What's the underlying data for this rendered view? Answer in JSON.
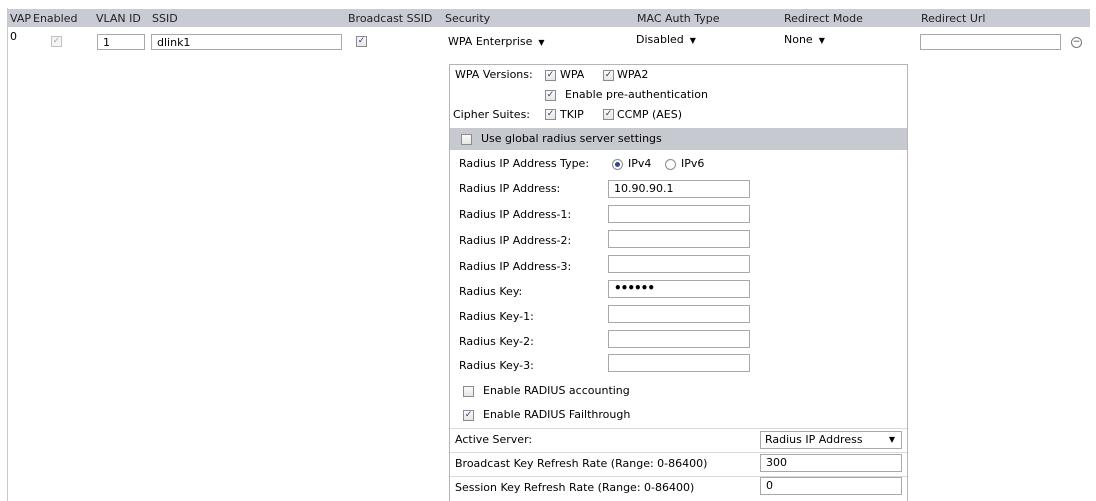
{
  "columns": {
    "vap": "VAP",
    "enabled": "Enabled",
    "vlan_id": "VLAN ID",
    "ssid": "SSID",
    "broadcast_ssid": "Broadcast SSID",
    "security": "Security",
    "mac_auth_type": "MAC Auth Type",
    "redirect_mode": "Redirect Mode",
    "redirect_url": "Redirect Url"
  },
  "row": {
    "vap": "0",
    "vlan_id": "1",
    "ssid": "dlink1",
    "security": "WPA Enterprise",
    "mac_auth_type": "Disabled",
    "redirect_mode": "None",
    "redirect_url": ""
  },
  "wpa": {
    "versions_label": "WPA Versions:",
    "wpa": "WPA",
    "wpa2": "WPA2",
    "preauth": "Enable pre-authentication",
    "cipher_label": "Cipher Suites:",
    "tkip": "TKIP",
    "ccmp": "CCMP (AES)"
  },
  "radius": {
    "use_global": "Use global radius server settings",
    "ip_type_label": "Radius IP Address Type:",
    "ipv4": "IPv4",
    "ipv6": "IPv6",
    "ip_label": "Radius IP Address:",
    "ip_value": "10.90.90.1",
    "ip1_label": "Radius IP Address-1:",
    "ip1_value": "",
    "ip2_label": "Radius IP Address-2:",
    "ip2_value": "",
    "ip3_label": "Radius IP Address-3:",
    "ip3_value": "",
    "key_label": "Radius Key:",
    "key_value": "••••••",
    "key1_label": "Radius Key-1:",
    "key1_value": "",
    "key2_label": "Radius Key-2:",
    "key2_value": "",
    "key3_label": "Radius Key-3:",
    "key3_value": "",
    "accounting": "Enable RADIUS accounting",
    "failthrough": "Enable RADIUS Failthrough",
    "active_server_label": "Active Server:",
    "active_server_value": "Radius IP Address",
    "bcast_label": "Broadcast Key Refresh Rate (Range: 0-86400)",
    "bcast_value": "300",
    "session_label": "Session Key Refresh Rate (Range: 0-86400)",
    "session_value": "0"
  },
  "icons": {
    "check": "✓",
    "dropdown": "▼",
    "remove": "−"
  }
}
